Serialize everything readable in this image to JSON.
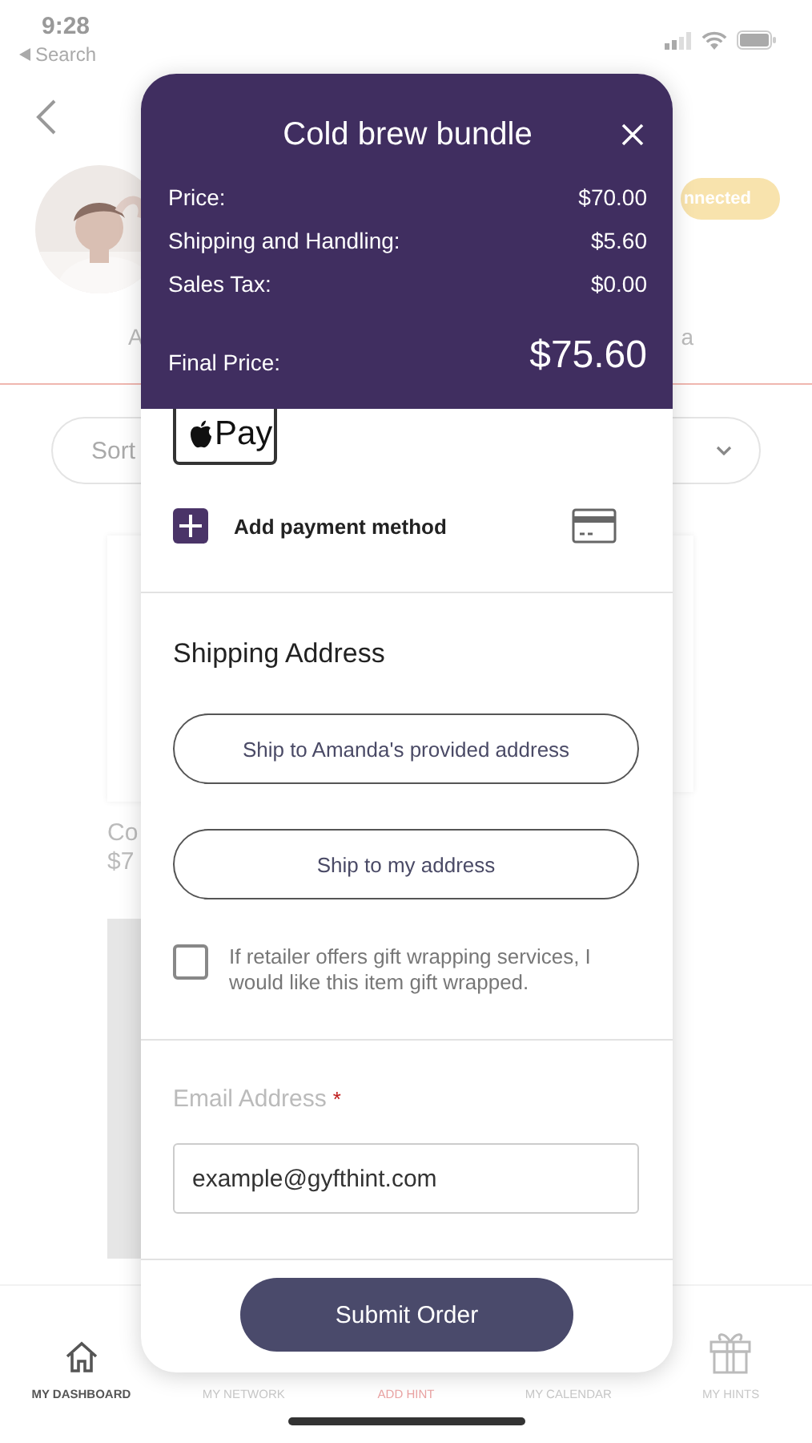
{
  "status_bar": {
    "time": "9:28",
    "back_label": "Search"
  },
  "background": {
    "badge": "nnected",
    "left_label": "A",
    "right_label": "a",
    "sort_label": "Sort",
    "card_title": "Co",
    "card_price": "$7"
  },
  "modal": {
    "title": "Cold brew bundle",
    "summary": [
      {
        "label": "Price:",
        "value": "$70.00"
      },
      {
        "label": "Shipping and Handling:",
        "value": "$5.60"
      },
      {
        "label": "Sales Tax:",
        "value": "$0.00"
      }
    ],
    "final": {
      "label": "Final Price:",
      "value": "$75.60"
    },
    "apple_pay": "Pay",
    "add_payment": "Add payment method",
    "shipping_heading": "Shipping Address",
    "shipping_options": [
      "Ship to Amanda's provided address",
      "Ship to my address"
    ],
    "gift_wrap": {
      "label": "If retailer offers gift wrapping services, I would like this item gift wrapped.",
      "checked": false
    },
    "email": {
      "label": "Email Address",
      "required_mark": "*",
      "value": "example@gyfthint.com"
    },
    "submit": "Submit Order"
  },
  "tab_bar": [
    {
      "label": "MY DASHBOARD",
      "kind": "home",
      "selected": true
    },
    {
      "label": "MY NETWORK",
      "kind": "plain",
      "selected": false
    },
    {
      "label": "ADD HINT",
      "kind": "accent",
      "selected": false
    },
    {
      "label": "MY CALENDAR",
      "kind": "plain",
      "selected": false
    },
    {
      "label": "MY HINTS",
      "kind": "gift",
      "selected": false
    }
  ]
}
